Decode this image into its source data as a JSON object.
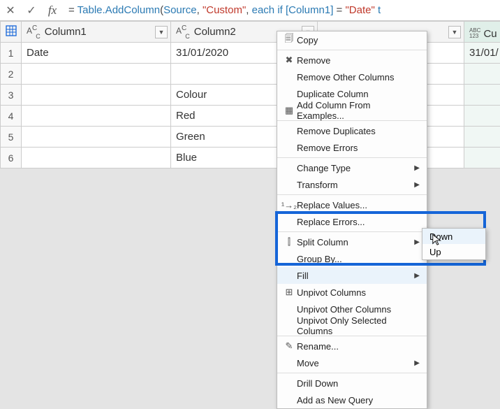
{
  "formula_bar": {
    "cancel_icon": "✕",
    "accept_icon": "✓",
    "fx_label": "fx",
    "formula_tokens": {
      "eq": "= ",
      "fn": "Table.AddColumn",
      "lp": "(",
      "src": "Source",
      "c1": ", ",
      "str": "\"Custom\"",
      "c2": ", ",
      "kw_each": "each",
      "sp1": " ",
      "kw_if": "if",
      "sp2": " ",
      "col": "[Column1]",
      "sp3": " ",
      "eq2": "=",
      "sp4": " ",
      "str2": "\"Date\"",
      "sp5": " ",
      "tail": "t"
    }
  },
  "columns": {
    "col1": {
      "type_icon": "A",
      "subc": "C",
      "name": "Column1"
    },
    "col2": {
      "type_icon": "A",
      "subc": "C",
      "name": "Column2"
    },
    "col4": {
      "type_icon": "ABC",
      "sub": "123",
      "name": "Cu"
    }
  },
  "rows": [
    {
      "n": "1",
      "c1": "Date",
      "c2": "31/01/2020",
      "c4": "31/01/"
    },
    {
      "n": "2",
      "c1": "",
      "c2": "",
      "c4": ""
    },
    {
      "n": "3",
      "c1": "",
      "c2": "Colour",
      "c4": ""
    },
    {
      "n": "4",
      "c1": "",
      "c2": "Red",
      "c4": ""
    },
    {
      "n": "5",
      "c1": "",
      "c2": "Green",
      "c4": ""
    },
    {
      "n": "6",
      "c1": "",
      "c2": "Blue",
      "c4": ""
    }
  ],
  "context_menu": {
    "copy": "Copy",
    "remove": "Remove",
    "remove_other": "Remove Other Columns",
    "duplicate": "Duplicate Column",
    "add_from_examples": "Add Column From Examples...",
    "remove_dups": "Remove Duplicates",
    "remove_errors": "Remove Errors",
    "change_type": "Change Type",
    "transform": "Transform",
    "replace_values": "Replace Values...",
    "replace_errors": "Replace Errors...",
    "split_column": "Split Column",
    "group_by": "Group By...",
    "fill": "Fill",
    "unpivot": "Unpivot Columns",
    "unpivot_other": "Unpivot Other Columns",
    "unpivot_only": "Unpivot Only Selected Columns",
    "rename": "Rename...",
    "move": "Move",
    "drill_down": "Drill Down",
    "add_as_new": "Add as New Query"
  },
  "submenu": {
    "down": "Down",
    "up": "Up"
  }
}
